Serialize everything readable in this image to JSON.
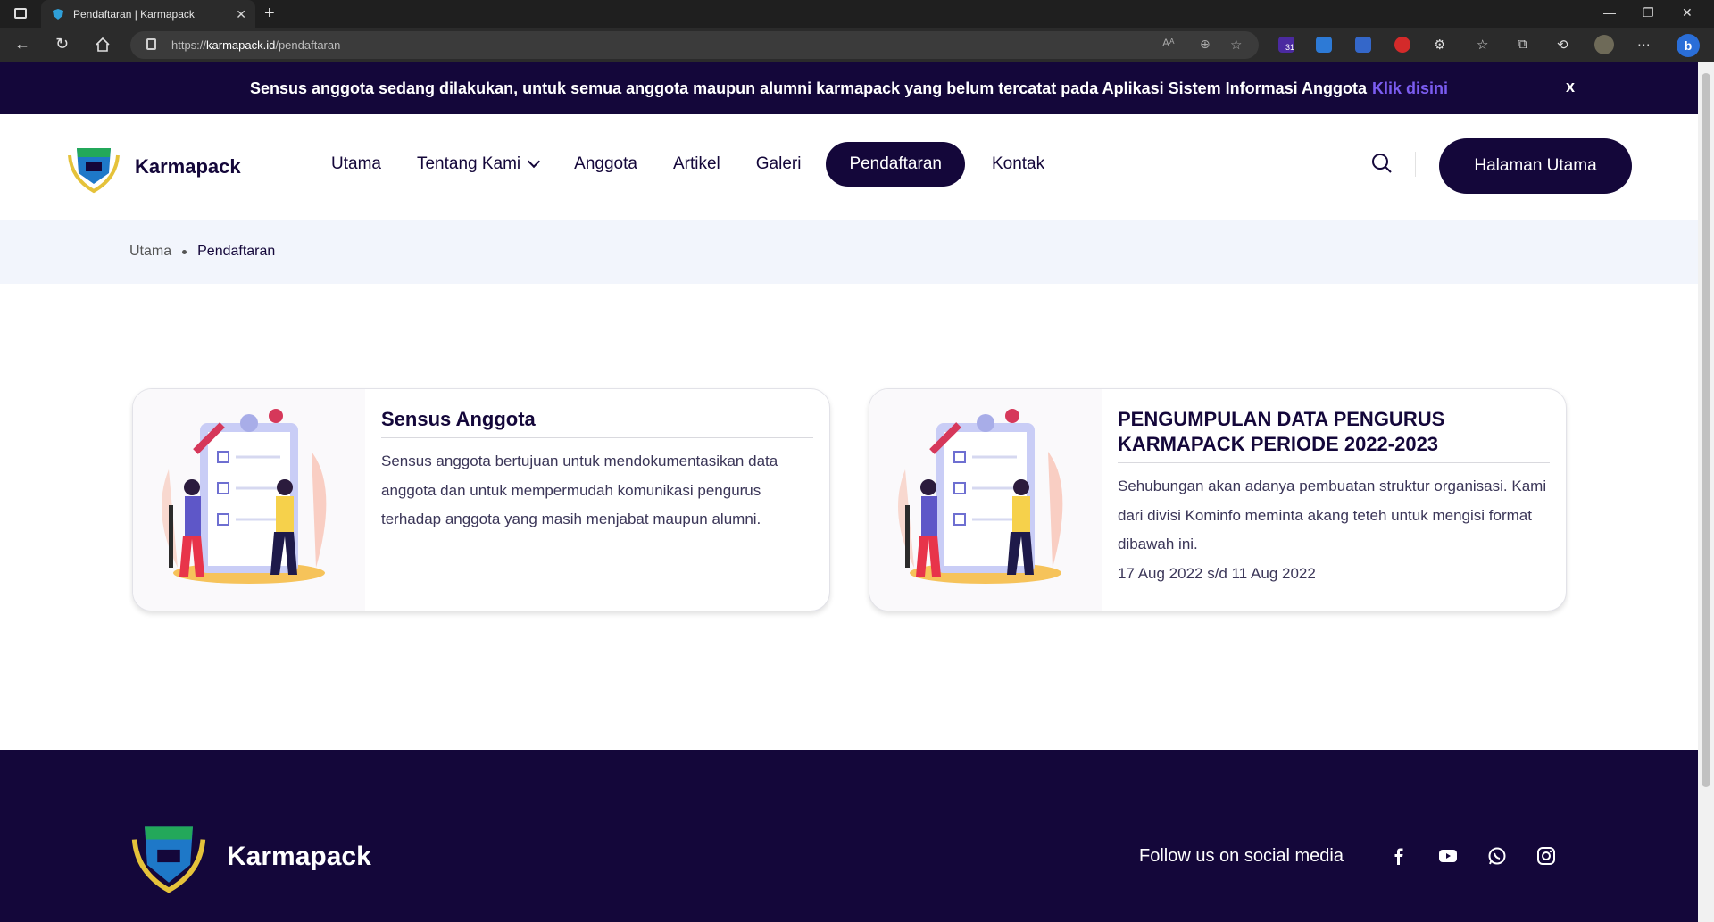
{
  "browser": {
    "tab_title": "Pendaftaran | Karmapack",
    "url_scheme": "https://",
    "url_host": "karmapack.id",
    "url_path": "/pendaftaran",
    "calendar_badge": "31"
  },
  "banner": {
    "text": "Sensus anggota sedang dilakukan, untuk semua anggota maupun alumni karmapack yang belum tercatat pada Aplikasi Sistem Informasi Anggota",
    "link": "Klik disini",
    "close": "x"
  },
  "header": {
    "brand": "Karmapack",
    "nav": [
      {
        "label": "Utama"
      },
      {
        "label": "Tentang Kami"
      },
      {
        "label": "Anggota"
      },
      {
        "label": "Artikel"
      },
      {
        "label": "Galeri"
      },
      {
        "label": "Pendaftaran"
      },
      {
        "label": "Kontak"
      }
    ],
    "cta": "Halaman Utama"
  },
  "breadcrumb": {
    "home": "Utama",
    "current": "Pendaftaran"
  },
  "cards": [
    {
      "title": "Sensus Anggota",
      "description": "Sensus anggota bertujuan untuk mendokumentasikan data anggota dan untuk mempermudah komunikasi pengurus terhadap anggota yang masih menjabat maupun alumni.",
      "date": ""
    },
    {
      "title": "PENGUMPULAN DATA PENGURUS KARMAPACK PERIODE 2022-2023",
      "description": "Sehubungan akan adanya pembuatan struktur organisasi. Kami dari divisi Kominfo meminta akang teteh untuk mengisi format dibawah ini.",
      "date": "17 Aug 2022 s/d 11 Aug 2022"
    }
  ],
  "footer": {
    "brand": "Karmapack",
    "follow": "Follow us on social media",
    "social_icons": [
      "facebook-icon",
      "youtube-icon",
      "whatsapp-icon",
      "instagram-icon"
    ]
  },
  "colors": {
    "primary": "#14073a",
    "link": "#7b5cf0",
    "breadcrumb_bg": "#f2f5fc"
  }
}
